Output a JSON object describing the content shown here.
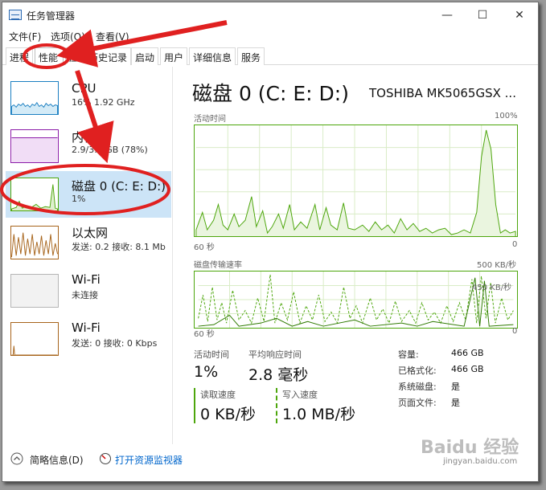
{
  "window": {
    "title": "任务管理器",
    "minimize": "—",
    "maximize": "☐",
    "close": "✕"
  },
  "menu": [
    "文件(F)",
    "选项(O)",
    "查看(V)"
  ],
  "tabs": [
    "进程",
    "性能",
    "应用历史记录",
    "启动",
    "用户",
    "详细信息",
    "服务"
  ],
  "active_tab": "性能",
  "sidebar": {
    "items": [
      {
        "name": "CPU",
        "sub": "16% 1.92 GHz",
        "icon": "cpu-graph"
      },
      {
        "name": "内存",
        "sub": "2.9/3.7 GB (78%)",
        "icon": "memory-graph"
      },
      {
        "name": "磁盘 0 (C: E: D:)",
        "sub": "1%",
        "icon": "disk-graph",
        "selected": true
      },
      {
        "name": "以太网",
        "sub": "发送: 0.2  接收: 8.1 Mb",
        "icon": "ethernet-graph"
      },
      {
        "name": "Wi-Fi",
        "sub": "未连接",
        "icon": "wifi-graph"
      },
      {
        "name": "Wi-Fi",
        "sub": "发送: 0 接收: 0 Kbps",
        "icon": "wifi-graph"
      }
    ]
  },
  "main": {
    "title": "磁盘 0 (C: E: D:)",
    "model": "TOSHIBA MK5065GSX ...",
    "graph1": {
      "label": "活动时间",
      "max": "100%",
      "xleft": "60 秒",
      "xright": "0"
    },
    "graph2": {
      "label": "磁盘传输速率",
      "max": "500 KB/秒",
      "inner": "450 KB/秒",
      "xleft": "60 秒",
      "xright": "0"
    },
    "stats": {
      "active_label": "活动时间",
      "active_value": "1%",
      "resp_label": "平均响应时间",
      "resp_value": "2.8 毫秒",
      "read_label": "读取速度",
      "read_value": "0 KB/秒",
      "write_label": "写入速度",
      "write_value": "1.0 MB/秒"
    },
    "info": [
      {
        "label": "容量:",
        "value": "466 GB"
      },
      {
        "label": "已格式化:",
        "value": "466 GB"
      },
      {
        "label": "系统磁盘:",
        "value": "是"
      },
      {
        "label": "页面文件:",
        "value": "是"
      }
    ]
  },
  "footer": {
    "summary": "简略信息(D)",
    "monitor": "打开资源监视器"
  },
  "watermark": {
    "text": "Baidu 经验",
    "sub": "jingyan.baidu.com"
  },
  "colors": {
    "accent": "#4da60c",
    "annotation": "#e02020",
    "selection": "#cce4f7"
  }
}
